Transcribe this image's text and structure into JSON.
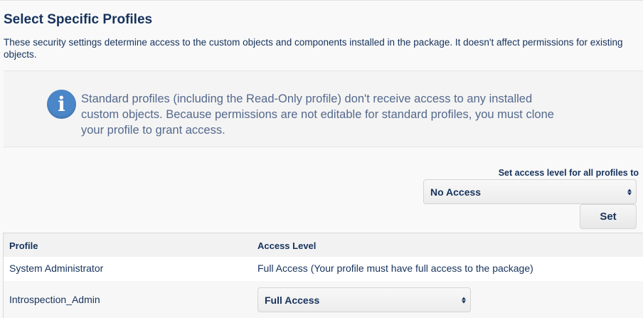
{
  "header": {
    "title": "Select Specific Profiles",
    "description": "These security settings determine access to the custom objects and components installed in the package. It doesn't affect permissions for existing objects."
  },
  "info": {
    "icon": "info-icon",
    "icon_glyph": "i",
    "icon_color": "#4a86c8",
    "text": "Standard profiles (including the Read-Only profile) don't receive access to any installed custom objects. Because permissions are not editable for standard profiles, you must clone your profile to grant access."
  },
  "bulk": {
    "label": "Set access level for all profiles to",
    "selected": "No Access",
    "button": "Set"
  },
  "table": {
    "columns": [
      "Profile",
      "Access Level"
    ],
    "rows": [
      {
        "profile": "System Administrator",
        "access": "Full Access (Your profile must have full access to the package)"
      },
      {
        "profile": "Introspection_Admin",
        "access": "Full Access"
      }
    ]
  }
}
